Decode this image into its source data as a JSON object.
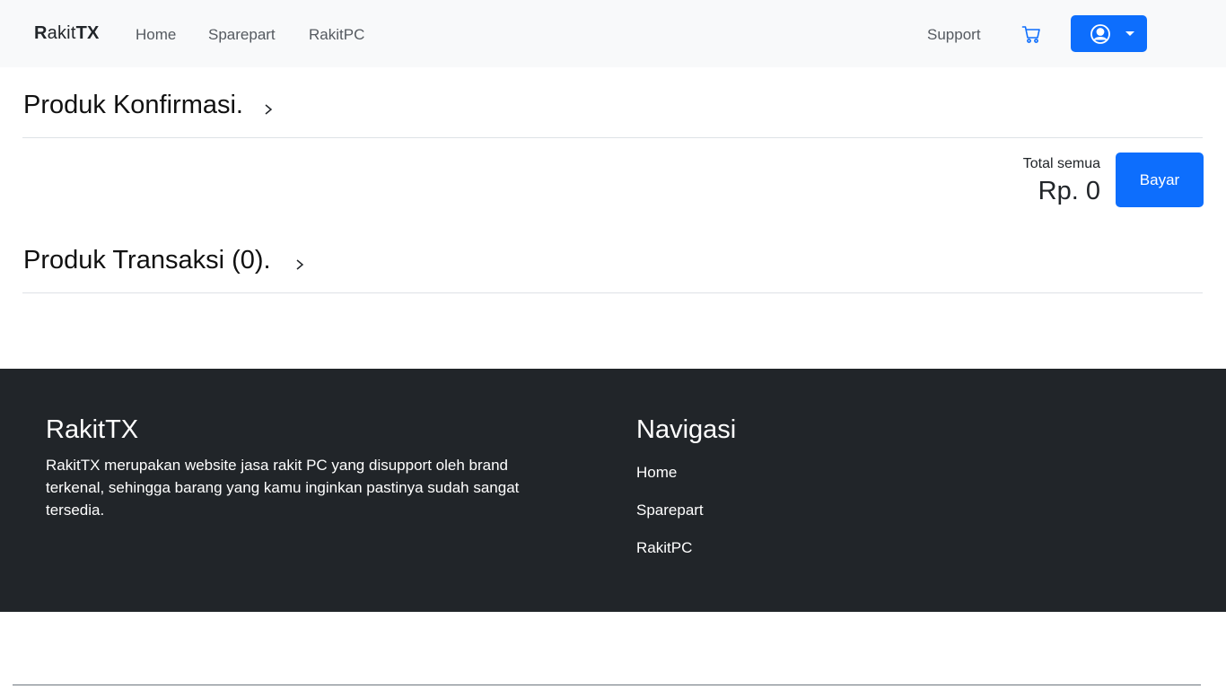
{
  "navbar": {
    "brand_part1": "R",
    "brand_part2": "akit",
    "brand_part3": "TX",
    "links": [
      "Home",
      "Sparepart",
      "RakitPC"
    ],
    "support_label": "Support",
    "icons": {
      "cart": "cart-icon",
      "user": "user-circle-icon",
      "caret": "caret-down-icon"
    },
    "accent_color": "#0d6efd"
  },
  "konfirmasi": {
    "title": "Produk Konfirmasi.",
    "total_label": "Total semua",
    "total_value": "Rp. 0",
    "pay_label": "Bayar"
  },
  "transaksi": {
    "title": "Produk Transaksi (0)."
  },
  "footer": {
    "brand": "RakitTX",
    "description": "RakitTX merupakan website jasa rakit PC yang disupport oleh brand terkenal, sehingga barang yang kamu inginkan pastinya sudah sangat tersedia.",
    "nav_title": "Navigasi",
    "links": [
      "Home",
      "Sparepart",
      "RakitPC"
    ],
    "background_color": "#212529"
  }
}
